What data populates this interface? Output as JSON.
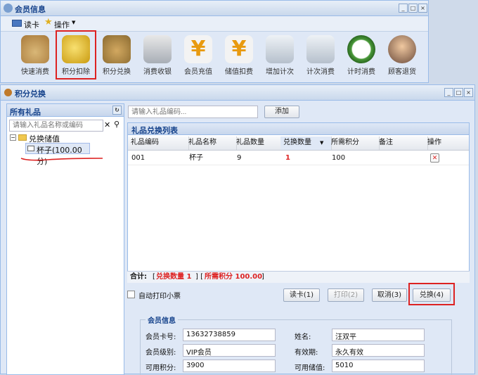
{
  "member_window": {
    "title": "会员信息",
    "menu": [
      {
        "label": "读卡",
        "icon": "card-reader-icon"
      },
      {
        "label": "操作",
        "icon": "star-icon"
      }
    ],
    "tools": [
      {
        "label": "快速消费",
        "icon": "money-bag-icon"
      },
      {
        "label": "积分扣除",
        "icon": "coins-minus-icon"
      },
      {
        "label": "积分兑换",
        "icon": "money-exchange-icon"
      },
      {
        "label": "消费收银",
        "icon": "cash-register-icon"
      },
      {
        "label": "会员充值",
        "icon": "yen-plus-icon"
      },
      {
        "label": "储值扣费",
        "icon": "yen-minus-icon"
      },
      {
        "label": "增加计次",
        "icon": "calculator-plus-icon"
      },
      {
        "label": "计次消费",
        "icon": "calculator-icon"
      },
      {
        "label": "计时消费",
        "icon": "clock-icon"
      },
      {
        "label": "顾客退货",
        "icon": "return-arrow-icon"
      }
    ]
  },
  "exchange_window": {
    "title": "积分兑换",
    "left_panel": {
      "title": "所有礼品",
      "search_placeholder": "请输入礼品名称或编码",
      "tree_root": "兑换储值",
      "tree_child": "杯子(100.00分)"
    },
    "gift_code_placeholder": "请输入礼品编码...",
    "add_label": "添加",
    "list_title": "礼品兑换列表",
    "columns": [
      "礼品编码",
      "礼品名称",
      "礼品数量",
      "兑换数量",
      "所需积分",
      "备注",
      "操作"
    ],
    "rows": [
      {
        "code": "001",
        "name": "杯子",
        "qty": "9",
        "exchange_qty": "1",
        "points": "100",
        "note": ""
      }
    ],
    "summary": {
      "label": "合计:",
      "qty_text": "兑换数量 1",
      "points_text": "所需积分 100.00"
    },
    "auto_print_label": "自动打印小票",
    "buttons": {
      "read_card": "读卡(1)",
      "print": "打印(2)",
      "cancel": "取消(3)",
      "exchange": "兑换(4)"
    },
    "member_info": {
      "legend": "会员信息",
      "card_label": "会员卡号:",
      "card_value": "13632738859",
      "name_label": "姓名:",
      "name_value": "汪双平",
      "level_label": "会员级别:",
      "level_value": "VIP会员",
      "validity_label": "有效期:",
      "validity_value": "永久有效",
      "points_label": "可用积分:",
      "points_value": "3900",
      "balance_label": "可用储值:",
      "balance_value": "5010"
    }
  },
  "colors": {
    "highlight": "#dd2222",
    "title": "#15428b",
    "border": "#99bbe8"
  }
}
